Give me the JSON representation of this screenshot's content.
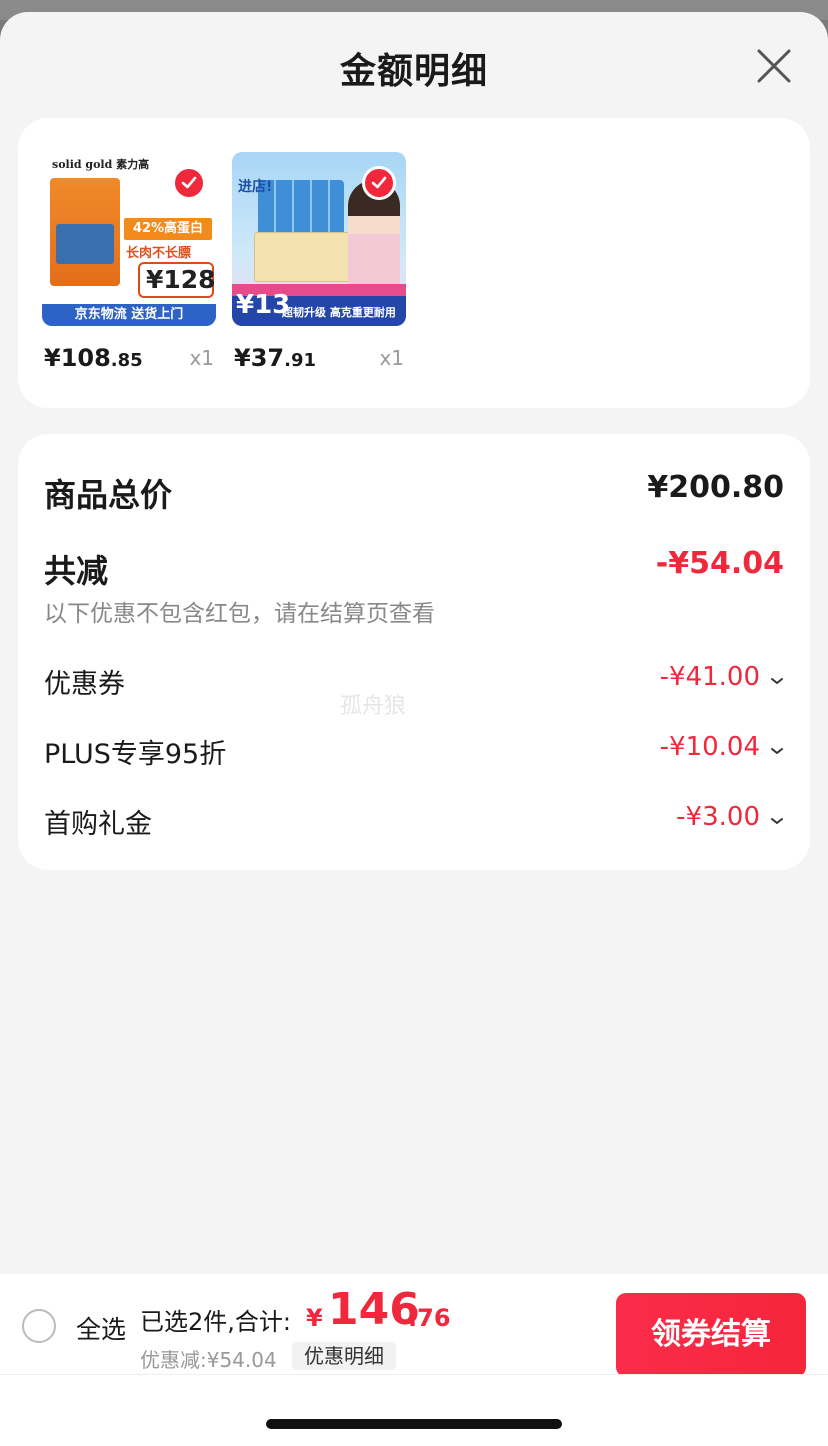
{
  "sheet": {
    "title": "金额明细"
  },
  "products": [
    {
      "price_int": "¥108",
      "price_dec": ".85",
      "qty": "x1",
      "thumb": {
        "brand": "solid gold 素力高",
        "tag": "42%高蛋白",
        "tagline": "长肉不长膘",
        "price_badge": "¥128",
        "bottom": "京东物流 送货上门"
      }
    },
    {
      "price_int": "¥37",
      "price_dec": ".91",
      "qty": "x1",
      "thumb": {
        "headline": "进店!",
        "badge_number": "¥13",
        "bottom": "超韧升级 高克重更耐用"
      }
    }
  ],
  "summary": {
    "total_label": "商品总价",
    "total_value": "¥200.80",
    "reduce_label": "共减",
    "reduce_value": "-¥54.04",
    "note": "以下优惠不包含红包，请在结算页查看",
    "items": [
      {
        "label": "优惠券",
        "value": "-¥41.00"
      },
      {
        "label": "PLUS专享95折",
        "value": "-¥10.04"
      },
      {
        "label": "首购礼金",
        "value": "-¥3.00"
      }
    ],
    "watermark": "孤舟狼"
  },
  "bottom_bar": {
    "select_all": "全选",
    "selected_summary": "已选2件,合计:",
    "total_yen": "¥",
    "total_int": "146",
    "total_dec": ".76",
    "discount_text": "优惠减:¥54.04",
    "detail_link": "优惠明细",
    "checkout": "领券结算"
  },
  "colors": {
    "accent": "#f0283c",
    "background": "#f4f4f4",
    "card": "#ffffff"
  }
}
